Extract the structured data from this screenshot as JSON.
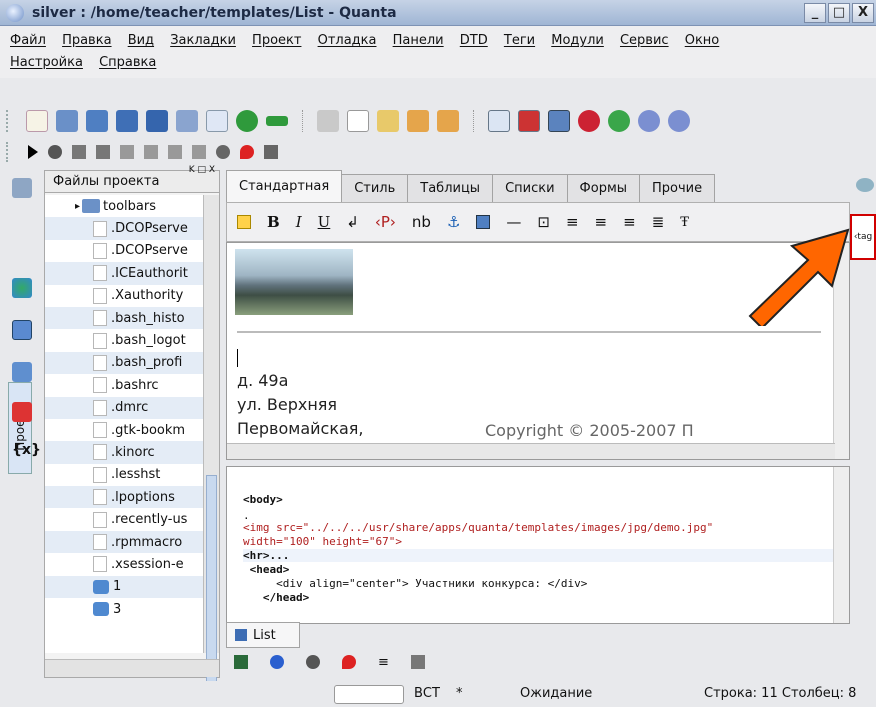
{
  "window": {
    "title": "silver : /home/teacher/templates/List - Quanta",
    "min": "_",
    "max": "□",
    "close": "X"
  },
  "menu": {
    "row1": [
      "Файл",
      "Правка",
      "Вид",
      "Закладки",
      "Проект",
      "Отладка",
      "Панели",
      "DTD",
      "Теги",
      "Модули",
      "Сервис",
      "Окно"
    ],
    "row2": [
      "Настройка",
      "Справка"
    ]
  },
  "sidebar": {
    "vertical_tab": "Проект"
  },
  "filepanel": {
    "title": "Файлы проекта",
    "items": [
      {
        "name": "toolbars",
        "kind": "folder"
      },
      {
        "name": ".DCOPserve",
        "kind": "file"
      },
      {
        "name": ".DCOPserve",
        "kind": "file"
      },
      {
        "name": ".ICEauthorit",
        "kind": "file"
      },
      {
        "name": ".Xauthority",
        "kind": "file"
      },
      {
        "name": ".bash_histo",
        "kind": "file"
      },
      {
        "name": ".bash_logot",
        "kind": "file"
      },
      {
        "name": ".bash_profi",
        "kind": "file"
      },
      {
        "name": ".bashrc",
        "kind": "file"
      },
      {
        "name": ".dmrc",
        "kind": "file"
      },
      {
        "name": ".gtk-bookm",
        "kind": "file"
      },
      {
        "name": ".kinorc",
        "kind": "file"
      },
      {
        "name": ".lesshst",
        "kind": "file"
      },
      {
        "name": ".lpoptions",
        "kind": "file"
      },
      {
        "name": ".recently-us",
        "kind": "file"
      },
      {
        "name": ".rpmmacro",
        "kind": "file"
      },
      {
        "name": ".xsession-e",
        "kind": "file"
      },
      {
        "name": "1",
        "kind": "net"
      },
      {
        "name": "3",
        "kind": "net"
      }
    ]
  },
  "editor": {
    "tabs": [
      "Стандартная",
      "Стиль",
      "Таблицы",
      "Списки",
      "Формы",
      "Прочие"
    ],
    "fmt": {
      "bold": "B",
      "italic": "I",
      "underline": "U",
      "nbsp": "nb"
    },
    "view_lines": [
      "д. 49а",
      "ул. Верхняя",
      "Первомайская,"
    ],
    "view_faded": "Copyright © 2005-2007 П",
    "code": [
      {
        "t": "<body>",
        "kind": "tag"
      },
      {
        "t": ".",
        "kind": "plain"
      },
      {
        "t": "<img src=\"../../../usr/share/apps/quanta/templates/images/jpg/demo.jpg\"",
        "kind": "img1"
      },
      {
        "t": "width=\"100\" height=\"67\">",
        "kind": "img2"
      },
      {
        "t": "<hr>...",
        "kind": "tag"
      },
      {
        "t": " <head>",
        "kind": "tag"
      },
      {
        "t": "     <div align=\"center\"> Участники конкурса: </div>",
        "kind": "div"
      },
      {
        "t": "   </head>",
        "kind": "tag"
      }
    ],
    "doc_tab": "List",
    "tag_panel_label": "‹tag"
  },
  "status": {
    "mode": "ВСТ",
    "modified": "*",
    "state": "Ожидание",
    "position": "Строка: 11 Столбец: 8"
  },
  "colors": {
    "accent": "#ff6600",
    "highlight_box": "#d00000"
  }
}
